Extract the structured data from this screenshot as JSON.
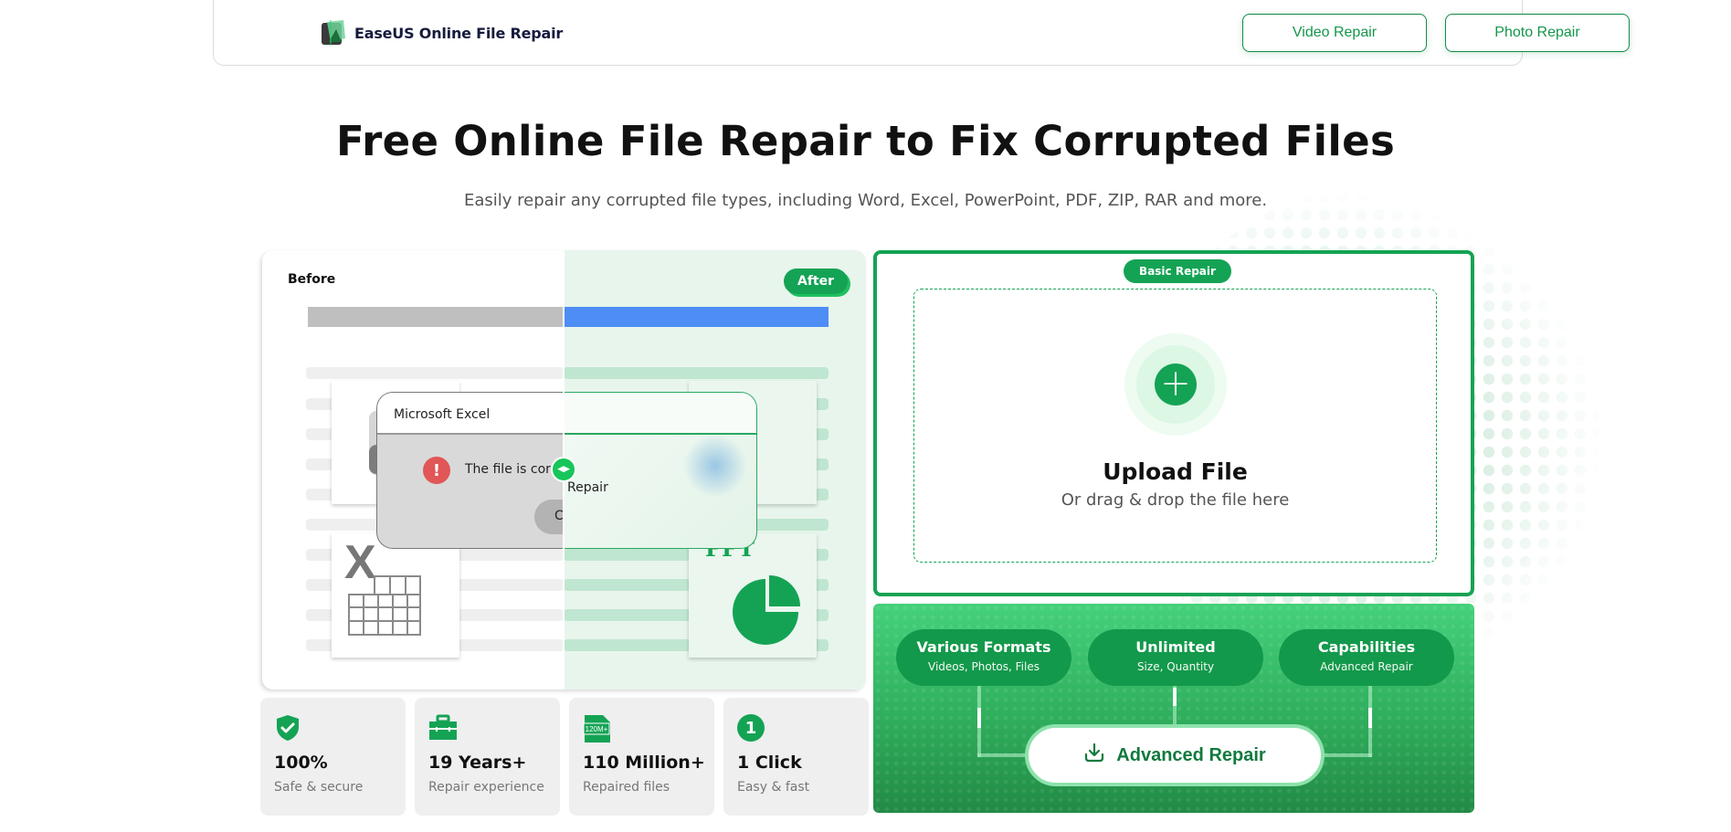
{
  "header": {
    "app_title": "EaseUS Online File Repair",
    "nav": [
      {
        "label": "Video Repair"
      },
      {
        "label": "Photo Repair"
      }
    ]
  },
  "hero": {
    "title": "Free Online File Repair to Fix Corrupted Files",
    "subtitle": "Easily repair any corrupted file types, including Word, Excel, PowerPoint, PDF, ZIP, RAR and more."
  },
  "comparison": {
    "before_label": "Before",
    "after_label": "After",
    "dialog_title": "Microsoft Excel",
    "dialog_message": "The file is corr",
    "dialog_ok_fragment": "C",
    "repair_label": "Repair",
    "excel_letter": "X",
    "ppt_label": "PPT",
    "error_glyph": "!"
  },
  "stats": [
    {
      "icon": "shield-check-icon",
      "value": "100%",
      "label": "Safe & secure"
    },
    {
      "icon": "toolbox-icon",
      "value": "19 Years+",
      "label": "Repair experience"
    },
    {
      "icon": "file-count-icon",
      "icon_text": "120M+",
      "value": "110 Million+",
      "label": "Repaired files"
    },
    {
      "icon": "number-one-icon",
      "icon_text": "1",
      "value": "1 Click",
      "label": "Easy & fast"
    }
  ],
  "upload": {
    "badge": "Basic Repair",
    "title": "Upload File",
    "subtitle": "Or drag & drop the file here"
  },
  "advanced": {
    "features": [
      {
        "title": "Various Formats",
        "subtitle": "Videos, Photos, Files"
      },
      {
        "title": "Unlimited",
        "subtitle": "Size, Quantity"
      },
      {
        "title": "Capabilities",
        "subtitle": "Advanced Repair"
      }
    ],
    "button_label": "Advanced Repair"
  },
  "colors": {
    "brand_green": "#14a354",
    "dark_green": "#117a3d",
    "blue": "#4d8df5",
    "error_red": "#e15656"
  }
}
